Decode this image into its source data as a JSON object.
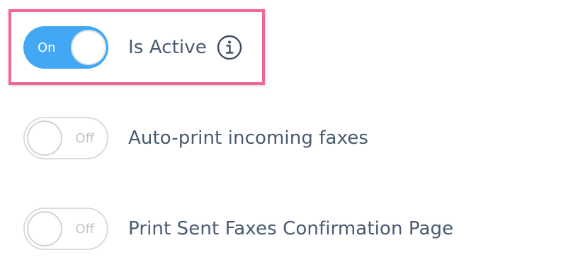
{
  "settings": {
    "is_active": {
      "label": "Is Active",
      "state": "On",
      "enabled": true,
      "info_icon": "info-icon"
    },
    "auto_print": {
      "label": "Auto-print incoming faxes",
      "state": "Off",
      "enabled": false
    },
    "print_sent_confirmation": {
      "label": "Print Sent Faxes Confirmation Page",
      "state": "Off",
      "enabled": false
    }
  },
  "colors": {
    "toggle_on": "#42a8f5",
    "highlight_border": "#f06792",
    "label_text": "#4a5a70"
  }
}
